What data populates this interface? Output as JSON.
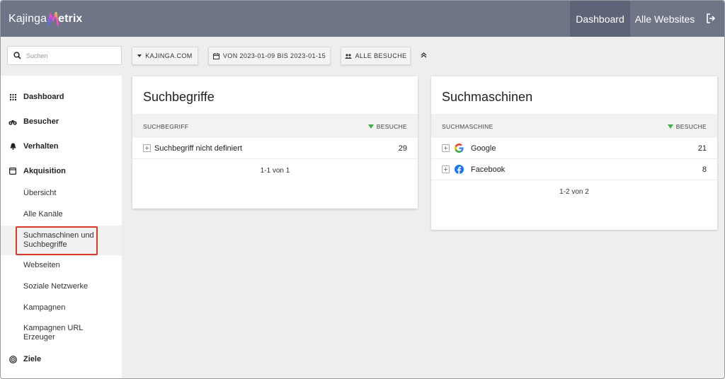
{
  "app": {
    "logo_prefix": "Kajinga",
    "logo_suffix": "etrix",
    "logo_letter": "M"
  },
  "topnav": {
    "dashboard": "Dashboard",
    "websites": "Alle Websites",
    "logout_icon": "logout-icon"
  },
  "toolbar": {
    "search_placeholder": "Suchen",
    "site": "KAJINGA.COM",
    "date_range": "VON 2023-01-09 BIS 2023-01-15",
    "segment": "ALLE BESUCHE"
  },
  "sidebar": {
    "main": [
      {
        "label": "Dashboard",
        "icon": "grid-icon"
      },
      {
        "label": "Besucher",
        "icon": "binoculars-icon"
      },
      {
        "label": "Verhalten",
        "icon": "bell-icon"
      },
      {
        "label": "Akquisition",
        "icon": "window-icon"
      },
      {
        "label": "Ziele",
        "icon": "target-icon"
      }
    ],
    "sub": [
      "Übersicht",
      "Alle Kanäle",
      "Suchmaschinen und",
      "Suchbegriffe",
      "Webseiten",
      "Soziale Netzwerke",
      "Kampagnen",
      "Kampagnen URL",
      "Erzeuger"
    ]
  },
  "card_keywords": {
    "title": "Suchbegriffe",
    "col_label": "SUCHBEGRIFF",
    "col_value": "BESUCHE",
    "rows": [
      {
        "label": "Suchbegriff nicht definiert",
        "value": "29"
      }
    ],
    "pager": "1-1 von 1"
  },
  "card_engines": {
    "title": "Suchmaschinen",
    "col_label": "SUCHMASCHINE",
    "col_value": "BESUCHE",
    "rows": [
      {
        "label": "Google",
        "value": "21",
        "icon": "google-icon"
      },
      {
        "label": "Facebook",
        "value": "8",
        "icon": "facebook-icon"
      }
    ],
    "pager": "1-2 von 2"
  },
  "colors": {
    "topbar": "#6e7587",
    "topbar_active": "#5d6477",
    "sort_indicator": "#3cb043",
    "highlight": "#e0392b"
  }
}
